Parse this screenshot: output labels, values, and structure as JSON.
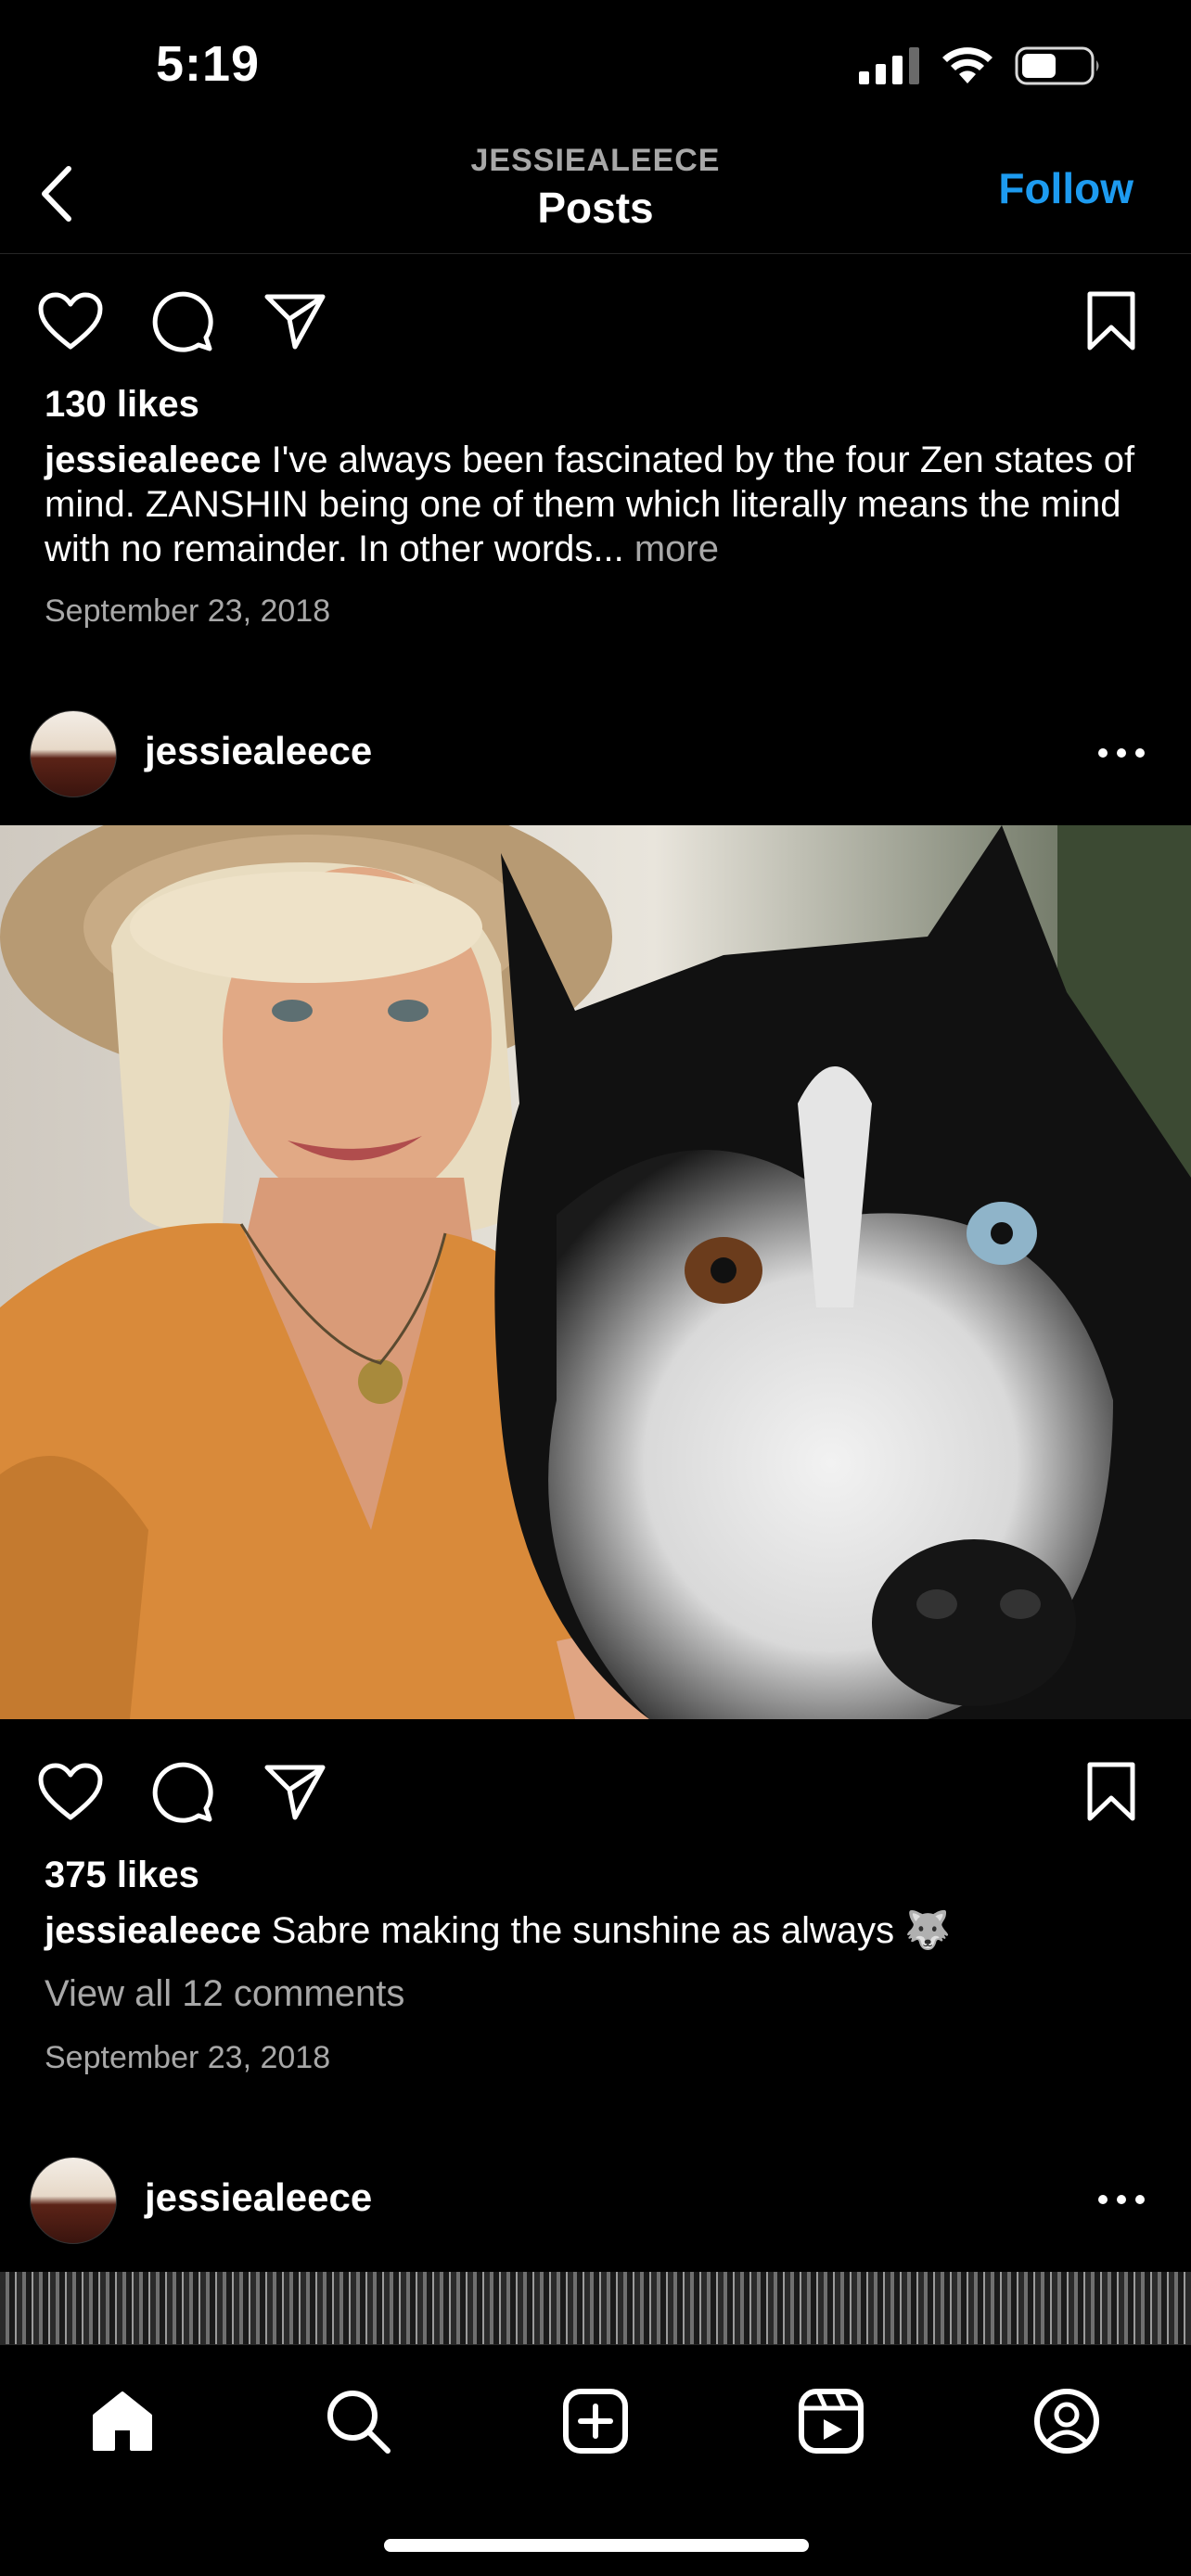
{
  "status_bar": {
    "time": "5:19"
  },
  "nav": {
    "subtitle": "JESSIEALEECE",
    "title": "Posts",
    "follow_label": "Follow"
  },
  "post1": {
    "likes": "130 likes",
    "caption_user": "jessiealeece",
    "caption_text": " I've always been fascinated by the four Zen states of mind. ZANSHIN being one of them which literally means the mind with no remainder. In other words...",
    "more_label": " more",
    "date": "September 23, 2018"
  },
  "post2": {
    "username": "jessiealeece",
    "likes": "375 likes",
    "caption_user": "jessiealeece",
    "caption_text": " Sabre making the sunshine as always 🐺",
    "comments_link": "View all 12 comments",
    "date": "September 23, 2018"
  },
  "post3": {
    "username": "jessiealeece"
  },
  "icons": {
    "back": "chevron-left-icon",
    "like": "heart-icon",
    "comment": "comment-icon",
    "share": "send-icon",
    "save": "bookmark-icon",
    "more": "more-horizontal-icon",
    "tabs": [
      "home-icon",
      "search-icon",
      "create-icon",
      "reels-icon",
      "profile-icon"
    ]
  },
  "colors": {
    "background": "#000000",
    "accent": "#1d9bf0",
    "secondary_text": "#a8a8a8"
  }
}
